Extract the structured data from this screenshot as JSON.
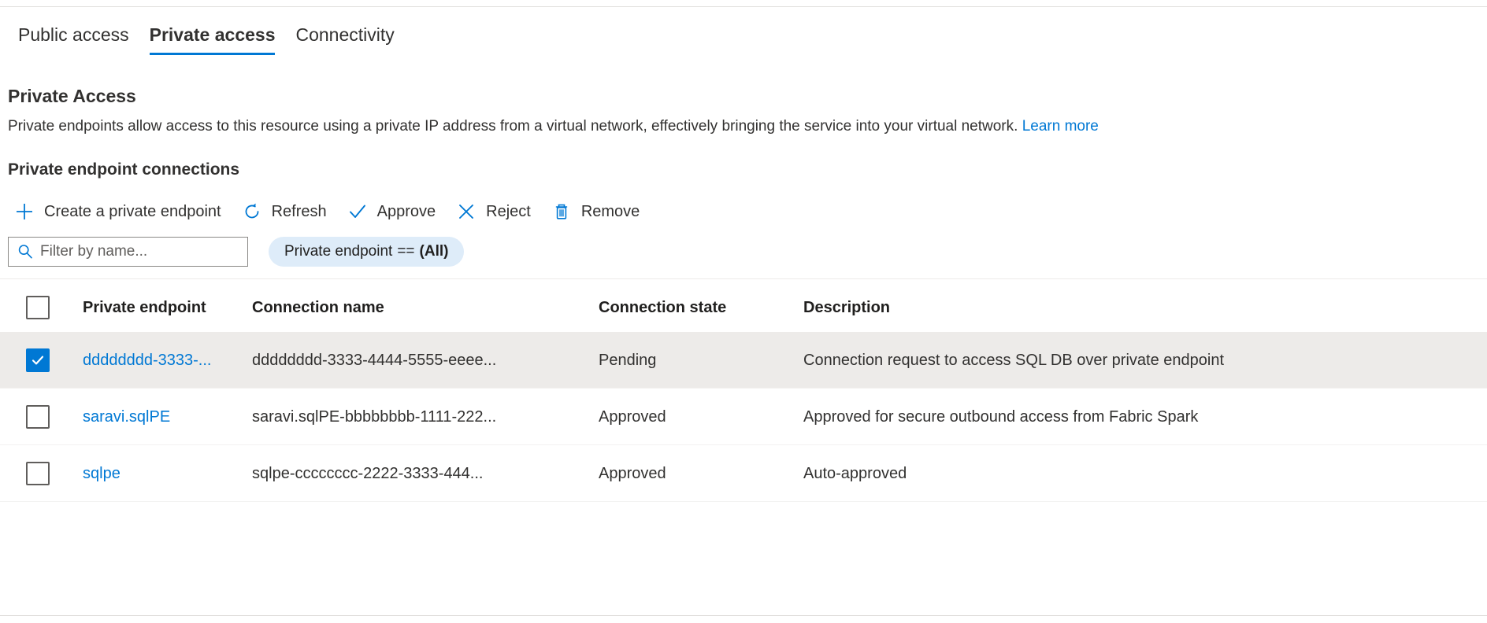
{
  "tabs": [
    {
      "label": "Public access",
      "active": false
    },
    {
      "label": "Private access",
      "active": true
    },
    {
      "label": "Connectivity",
      "active": false
    }
  ],
  "section": {
    "title": "Private Access",
    "description": "Private endpoints allow access to this resource using a private IP address from a virtual network, effectively bringing the service into your virtual network.",
    "learn_more": "Learn more",
    "subsection_title": "Private endpoint connections"
  },
  "commandbar": [
    {
      "label": "Create a private endpoint",
      "icon": "plus-icon"
    },
    {
      "label": "Refresh",
      "icon": "refresh-icon"
    },
    {
      "label": "Approve",
      "icon": "checkmark-icon"
    },
    {
      "label": "Reject",
      "icon": "cross-icon"
    },
    {
      "label": "Remove",
      "icon": "trash-icon"
    }
  ],
  "filter": {
    "placeholder": "Filter by name...",
    "value": "",
    "pill": {
      "field": "Private endpoint",
      "operator": "==",
      "value": "(All)"
    }
  },
  "table": {
    "columns": [
      "Private endpoint",
      "Connection name",
      "Connection state",
      "Description"
    ],
    "rows": [
      {
        "selected": true,
        "endpoint": "dddddddd-3333-...",
        "connection_name": "dddddddd-3333-4444-5555-eeee...",
        "connection_state": "Pending",
        "description": "Connection request to access SQL DB over private endpoint"
      },
      {
        "selected": false,
        "endpoint": "saravi.sqlPE",
        "connection_name": "saravi.sqlPE-bbbbbbbb-1111-222...",
        "connection_state": "Approved",
        "description": "Approved for secure outbound access from Fabric Spark"
      },
      {
        "selected": false,
        "endpoint": "sqlpe",
        "connection_name": "sqlpe-cccccccc-2222-3333-444...",
        "connection_state": "Approved",
        "description": "Auto-approved"
      }
    ]
  },
  "colors": {
    "accent": "#0078d4",
    "selected_row": "#edebe9",
    "pill_bg": "#deecf9"
  }
}
